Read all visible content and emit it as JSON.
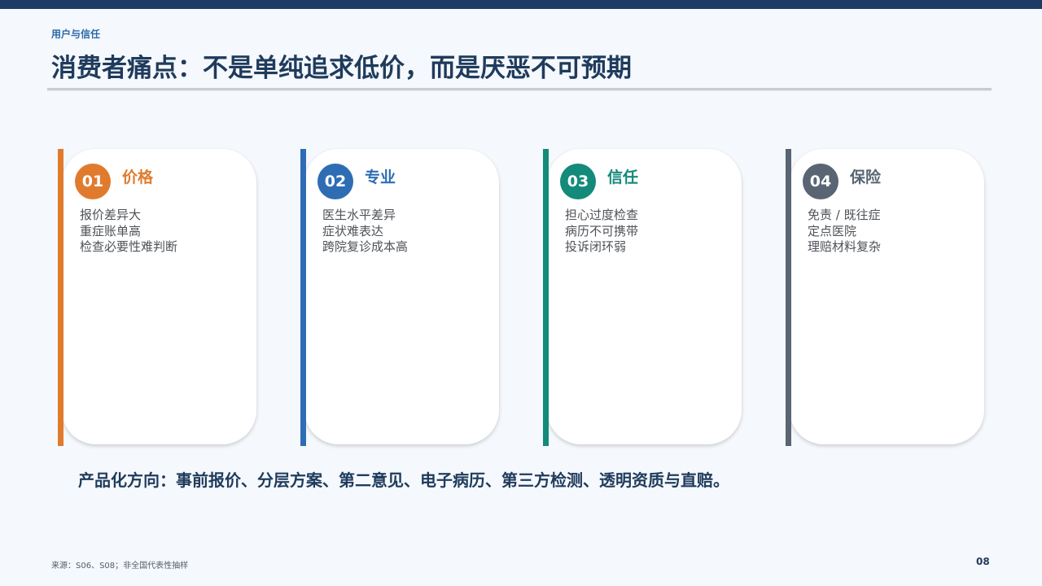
{
  "header": {
    "section_tag": "用户与信任",
    "title": "消费者痛点：不是单纯追求低价，而是厌恶不可预期"
  },
  "cards": [
    {
      "number": "01",
      "title": "价格",
      "color": "#e07b2e",
      "points": [
        "报价差异大",
        "重症账单高",
        "检查必要性难判断"
      ]
    },
    {
      "number": "02",
      "title": "专业",
      "color": "#2e6db4",
      "points": [
        "医生水平差异",
        "症状难表达",
        "跨院复诊成本高"
      ]
    },
    {
      "number": "03",
      "title": "信任",
      "color": "#138a7a",
      "points": [
        "担心过度检查",
        "病历不可携带",
        "投诉闭环弱"
      ]
    },
    {
      "number": "04",
      "title": "保险",
      "color": "#596573",
      "points": [
        "免责 / 既往症",
        "定点医院",
        "理赔材料复杂"
      ]
    }
  ],
  "direction": "产品化方向：事前报价、分层方案、第二意见、电子病历、第三方检测、透明资质与直赔。",
  "footer": {
    "source": "来源：S06、S08；非全国代表性抽样",
    "page_number": "08"
  },
  "colors": {
    "top_bar": "#1d3c64",
    "title": "#1f3b5c",
    "background": "#f5f8fc"
  }
}
